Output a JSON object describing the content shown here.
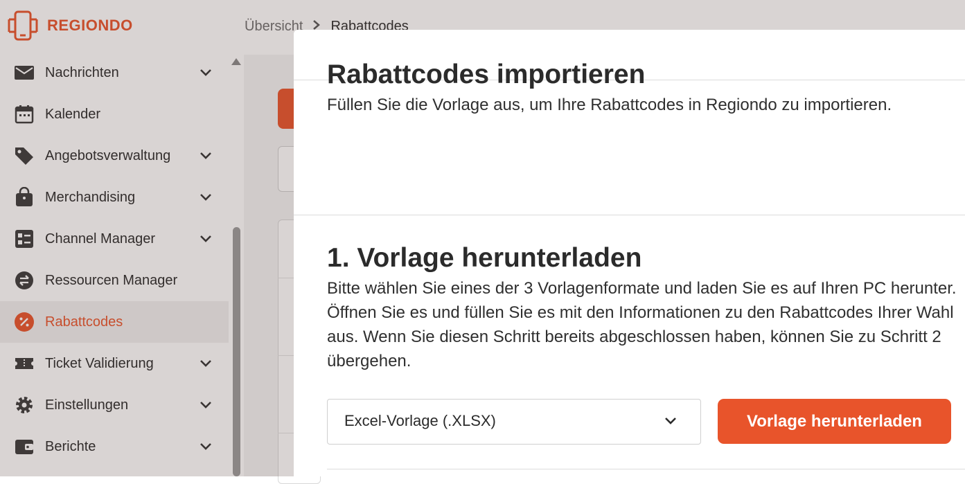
{
  "brand": {
    "name": "REGIONDO",
    "accent_color": "#e8542b"
  },
  "breadcrumb": {
    "items": [
      "Übersicht",
      "Rabattcodes"
    ],
    "separator_icon": "chevron-right-icon"
  },
  "sidebar": {
    "items": [
      {
        "label": "Nachrichten",
        "icon": "mail-icon",
        "expandable": true,
        "active": false
      },
      {
        "label": "Kalender",
        "icon": "calendar-icon",
        "expandable": false,
        "active": false
      },
      {
        "label": "Angebotsverwaltung",
        "icon": "tag-icon",
        "expandable": true,
        "active": false
      },
      {
        "label": "Merchandising",
        "icon": "shopping-bag-icon",
        "expandable": true,
        "active": false
      },
      {
        "label": "Channel Manager",
        "icon": "channel-icon",
        "expandable": true,
        "active": false
      },
      {
        "label": "Ressourcen Manager",
        "icon": "swap-icon",
        "expandable": false,
        "active": false
      },
      {
        "label": "Rabattcodes",
        "icon": "percent-icon",
        "expandable": false,
        "active": true
      },
      {
        "label": "Ticket Validierung",
        "icon": "ticket-icon",
        "expandable": true,
        "active": false
      },
      {
        "label": "Einstellungen",
        "icon": "gear-icon",
        "expandable": true,
        "active": false
      },
      {
        "label": "Berichte",
        "icon": "wallet-icon",
        "expandable": true,
        "active": false
      }
    ]
  },
  "drawer": {
    "title": "Rabattcodes importieren",
    "subtitle": "Füllen Sie die Vorlage aus, um Ihre Rabattcodes in Regiondo zu importieren.",
    "step1": {
      "title": "1. Vorlage herunterladen",
      "description": "Bitte wählen Sie eines der 3 Vorlagenformate und laden Sie es auf Ihren PC herunter. Öffnen Sie es und füllen Sie es mit den Informationen zu den Rabattcodes Ihrer Wahl aus. Wenn Sie diesen Schritt bereits abgeschlossen haben, können Sie zu Schritt 2 übergehen.",
      "format_select": {
        "value": "Excel-Vorlage (.XLSX)"
      },
      "download_button": "Vorlage herunterladen"
    }
  }
}
